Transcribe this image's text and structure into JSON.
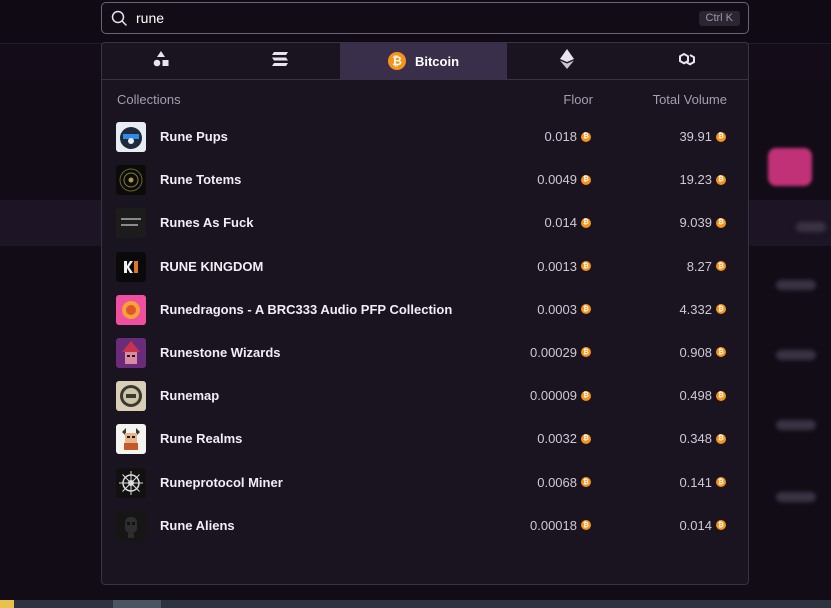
{
  "search": {
    "value": "rune",
    "shortcut": "Ctrl K"
  },
  "tabs": [
    {
      "icon": "shapes-icon",
      "label": ""
    },
    {
      "icon": "solana-icon",
      "label": ""
    },
    {
      "icon": "bitcoin-icon",
      "label": "Bitcoin",
      "active": true
    },
    {
      "icon": "ethereum-icon",
      "label": ""
    },
    {
      "icon": "polygon-icon",
      "label": ""
    }
  ],
  "table": {
    "headers": {
      "name": "Collections",
      "floor": "Floor",
      "volume": "Total Volume"
    },
    "rows": [
      {
        "name": "Rune Pups",
        "floor": "0.018",
        "volume": "39.91"
      },
      {
        "name": "Rune Totems",
        "floor": "0.0049",
        "volume": "19.23"
      },
      {
        "name": "Runes As Fuck",
        "floor": "0.014",
        "volume": "9.039"
      },
      {
        "name": "RUNE KINGDOM",
        "floor": "0.0013",
        "volume": "8.27"
      },
      {
        "name": "Runedragons - A BRC333 Audio PFP Collection",
        "floor": "0.0003",
        "volume": "4.332"
      },
      {
        "name": "Runestone Wizards",
        "floor": "0.00029",
        "volume": "0.908"
      },
      {
        "name": "Runemap",
        "floor": "0.00009",
        "volume": "0.498"
      },
      {
        "name": "Rune Realms",
        "floor": "0.0032",
        "volume": "0.348"
      },
      {
        "name": "Runeprotocol Miner",
        "floor": "0.0068",
        "volume": "0.141"
      },
      {
        "name": "Rune Aliens",
        "floor": "0.00018",
        "volume": "0.014"
      }
    ]
  },
  "colors": {
    "accent_btc": "#f7931a",
    "active_tab": "#3a2f4a",
    "panel": "#1a1320"
  }
}
